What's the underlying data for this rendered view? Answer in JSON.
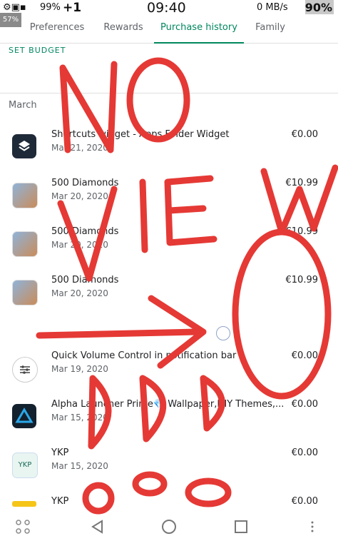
{
  "status_bar": {
    "time": "09:40",
    "plus": "+1",
    "signal_percent": "99%",
    "network_speed": "0 MB/s",
    "battery": "90%",
    "corner_badge": "57%"
  },
  "tabs": [
    {
      "label": "Preferences",
      "active": false
    },
    {
      "label": "Rewards",
      "active": false
    },
    {
      "label": "Purchase history",
      "active": true
    },
    {
      "label": "Family",
      "active": false
    }
  ],
  "accent_color": "#01875f",
  "set_budget_label": "SET BUDGET",
  "section_header": "March",
  "purchases": [
    {
      "name": "Shortcuts widget - Apps Folder Widget",
      "date": "Mar 21, 2020",
      "price": "€0.00",
      "icon": "layers-icon"
    },
    {
      "name": "500 Diamonds",
      "date": "Mar 20, 2020",
      "price": "€10.99",
      "icon": "game-character-icon"
    },
    {
      "name": "500 Diamonds",
      "date": "Mar 20, 2020",
      "price": "€10.99",
      "icon": "game-character-icon"
    },
    {
      "name": "500 Diamonds",
      "date": "Mar 20, 2020",
      "price": "€10.99",
      "icon": "game-character-icon"
    },
    {
      "name": "Quick Volume Control in notification bar",
      "date": "Mar 19, 2020",
      "price": "€0.00",
      "icon": "sliders-icon"
    },
    {
      "name": "Alpha Launcher Prime💎 Wallpaper,DIY Themes,...",
      "date": "Mar 15, 2020",
      "price": "€0.00",
      "icon": "triangle-logo-icon"
    },
    {
      "name": "YKP",
      "date": "Mar 15, 2020",
      "price": "€0.00",
      "icon": "ykp-icon"
    },
    {
      "name": "YKP",
      "date": "",
      "price": "€0.00",
      "icon": "ykp-yellow-icon"
    }
  ],
  "ykp_icon_text": "YKP",
  "graffiti": {
    "color": "#e53935",
    "words": [
      "NO",
      "VIEW",
      "DDD"
    ]
  }
}
